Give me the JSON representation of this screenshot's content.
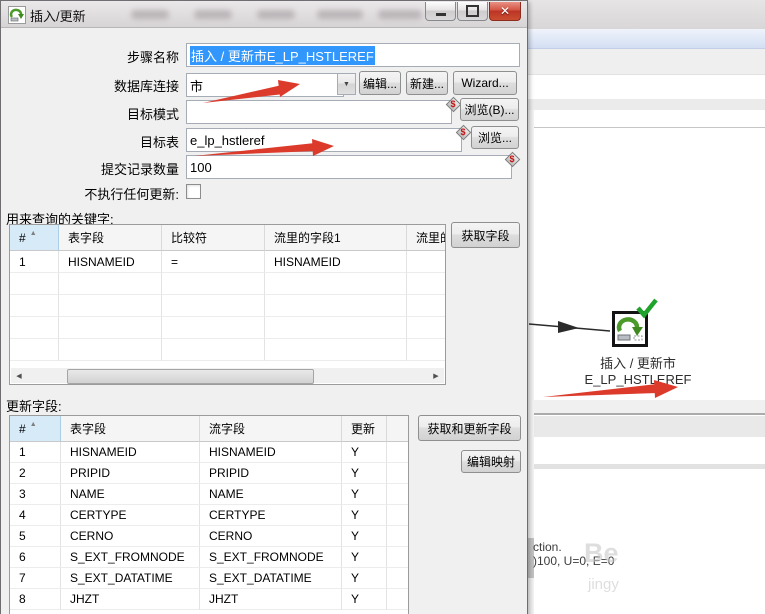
{
  "colors": {
    "annotation": "#DC3B2C",
    "hop": "#2B2B2B"
  },
  "icons": {
    "dropdown": "▼",
    "sort_asc": "▲",
    "scroll_left": "◀",
    "scroll_right": "▶",
    "variable": "$",
    "close": "✕"
  },
  "window": {
    "title": "插入/更新"
  },
  "form": {
    "step_name": {
      "label": "步骤名称",
      "value": "插入 / 更新市E_LP_HSTLEREF"
    },
    "connection": {
      "label": "数据库连接",
      "value": "市",
      "edit": "编辑...",
      "new": "新建...",
      "wizard": "Wizard..."
    },
    "schema": {
      "label": "目标模式",
      "value": "",
      "browse": "浏览(B)..."
    },
    "table": {
      "label": "目标表",
      "value": "e_lp_hstleref",
      "browse": "浏览..."
    },
    "commit": {
      "label": "提交记录数量",
      "value": "100"
    },
    "skip": {
      "label": "不执行任何更新:"
    }
  },
  "keys": {
    "title": "用来查询的关键字:",
    "columns": [
      "#",
      "表字段",
      "比较符",
      "流里的字段1",
      "流里的"
    ],
    "rows": [
      [
        "1",
        "HISNAMEID",
        "=",
        "HISNAMEID",
        ""
      ]
    ],
    "get_fields": "获取字段"
  },
  "update": {
    "title": "更新字段:",
    "columns": [
      "#",
      "表字段",
      "流字段",
      "更新"
    ],
    "rows": [
      [
        "1",
        "HISNAMEID",
        "HISNAMEID",
        "Y"
      ],
      [
        "2",
        "PRIPID",
        "PRIPID",
        "Y"
      ],
      [
        "3",
        "NAME",
        "NAME",
        "Y"
      ],
      [
        "4",
        "CERTYPE",
        "CERTYPE",
        "Y"
      ],
      [
        "5",
        "CERNO",
        "CERNO",
        "Y"
      ],
      [
        "6",
        "S_EXT_FROMNODE",
        "S_EXT_FROMNODE",
        "Y"
      ],
      [
        "7",
        "S_EXT_DATATIME",
        "S_EXT_DATATIME",
        "Y"
      ],
      [
        "8",
        "JHZT",
        "JHZT",
        "Y"
      ]
    ],
    "get_update_fields": "获取和更新字段",
    "edit_mapping": "编辑映射"
  },
  "canvas": {
    "step_label": "插入 / 更新市E_LP_HSTLEREF",
    "log_line1": "ction.",
    "log_line2": ")100, U=0, E=0",
    "watermark1": "Be",
    "watermark2": "jingy"
  }
}
